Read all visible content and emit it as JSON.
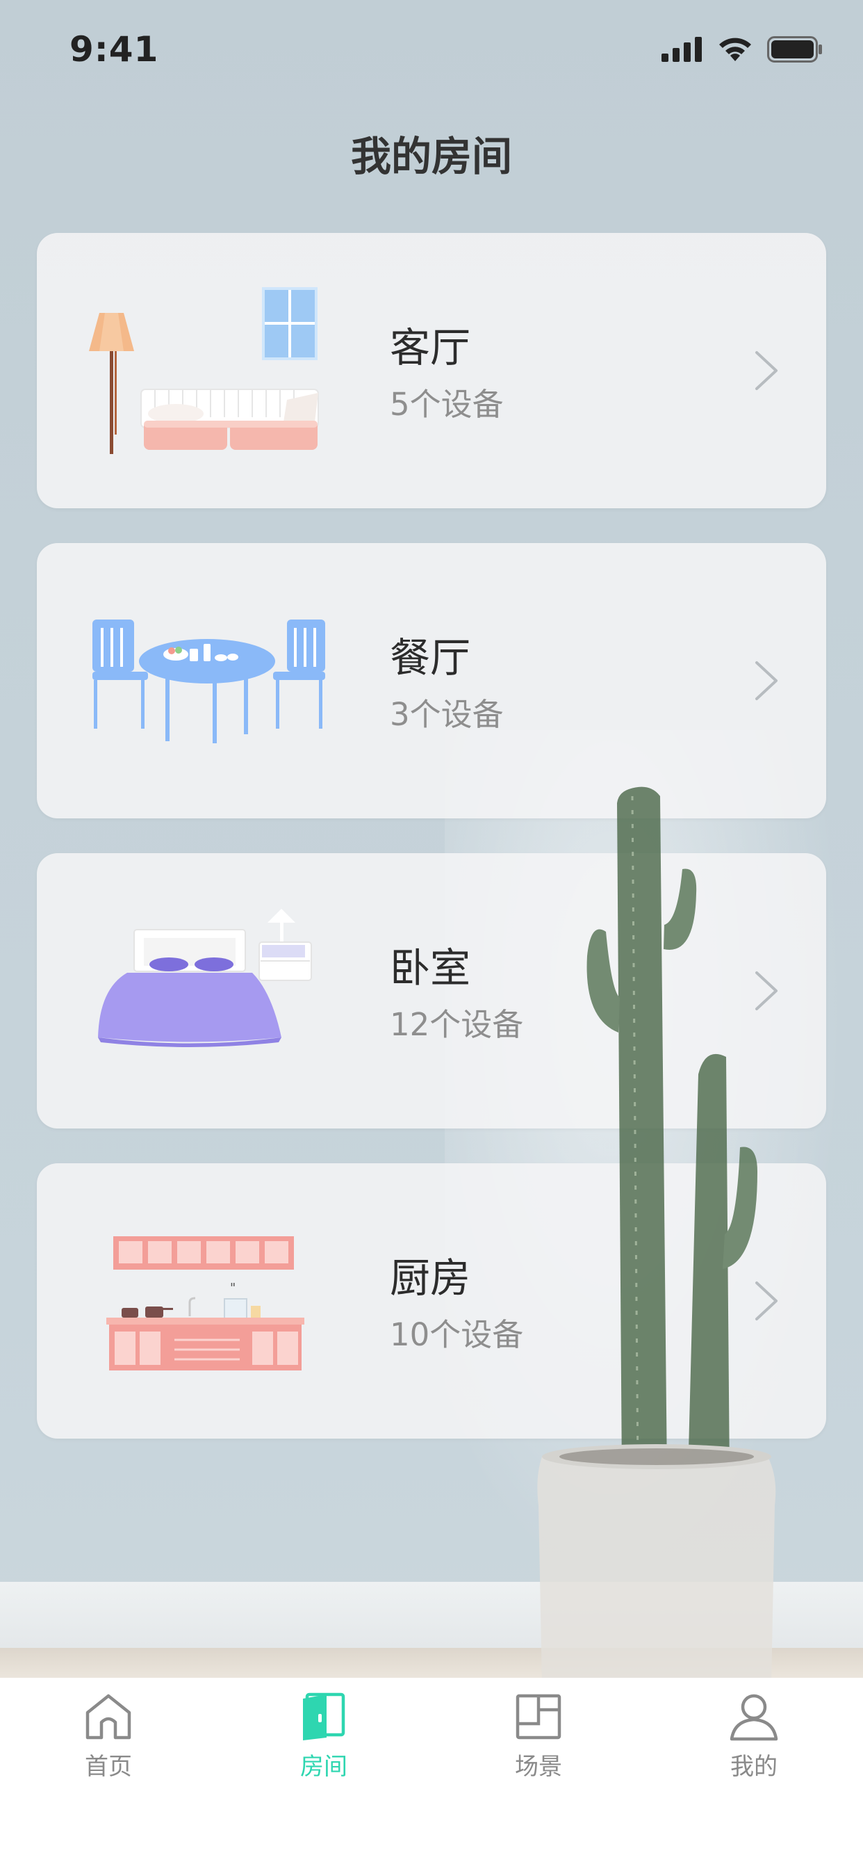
{
  "status_bar": {
    "time": "9:41"
  },
  "page": {
    "title": "我的房间"
  },
  "rooms": [
    {
      "name": "客厅",
      "devices": "5个设备",
      "illustration": "living-room-illustration"
    },
    {
      "name": "餐厅",
      "devices": "3个设备",
      "illustration": "dining-room-illustration"
    },
    {
      "name": "卧室",
      "devices": "12个设备",
      "illustration": "bedroom-illustration"
    },
    {
      "name": "厨房",
      "devices": "10个设备",
      "illustration": "kitchen-illustration"
    }
  ],
  "tab_bar": {
    "active_color": "#2ed6b0",
    "inactive_color": "#8a8a8a",
    "tabs": [
      {
        "label": "首页",
        "icon": "home-icon",
        "active": false
      },
      {
        "label": "房间",
        "icon": "door-icon",
        "active": true
      },
      {
        "label": "场景",
        "icon": "scene-icon",
        "active": false
      },
      {
        "label": "我的",
        "icon": "user-icon",
        "active": false
      }
    ]
  }
}
